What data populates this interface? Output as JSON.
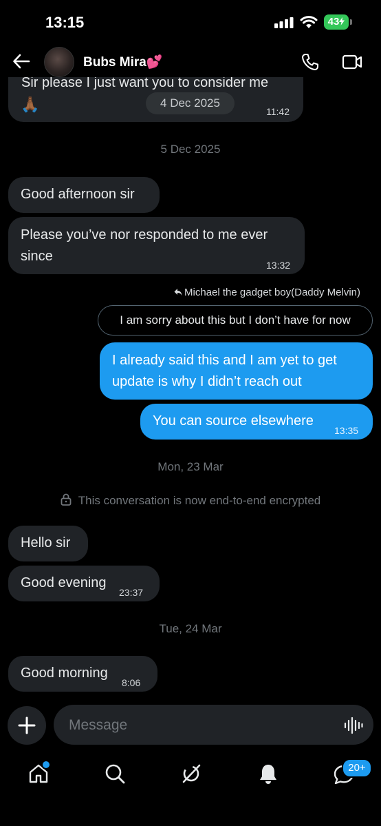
{
  "status_bar": {
    "time": "13:15",
    "battery": "43"
  },
  "header": {
    "contact_name": "Bubs Mira💕"
  },
  "messages": {
    "m0_text": "Sir please I just want you to consider me",
    "m0_emoji": "🙏🏾",
    "m0_pill": "4 Dec 2025",
    "m0_time": "11:42",
    "date_1": "5 Dec 2025",
    "m1_text": "Good afternoon sir",
    "m2_text_line1": "Please you’ve nor responded to me ever",
    "m2_text_line2": "since",
    "m2_time": "13:32",
    "reply_to_label": "Michael the gadget boy(Daddy Melvin)",
    "quoted_text": "I am sorry about this but I don’t have for now",
    "m3_text_line1": "I already said this and I am yet to get",
    "m3_text_line2": "update is why I didn’t reach out",
    "m4_text": "You can source elsewhere",
    "m4_time": "13:35",
    "date_2": "Mon, 23 Mar",
    "encryption_notice": "This conversation is now end-to-end encrypted",
    "m5_text": "Hello sir",
    "m6_text": "Good evening",
    "m6_time": "23:37",
    "date_3": "Tue, 24 Mar",
    "m7_text": "Good morning",
    "m7_time": "8:06"
  },
  "composer": {
    "placeholder": "Message"
  },
  "bottom_nav": {
    "items": [
      "home-icon",
      "search-icon",
      "grok-icon",
      "notifications-icon",
      "messages-icon"
    ],
    "messages_badge": "20+"
  },
  "colors": {
    "accent": "#1d9bf0",
    "incoming_bubble": "#202327",
    "background": "#000000",
    "battery": "#34c759"
  }
}
